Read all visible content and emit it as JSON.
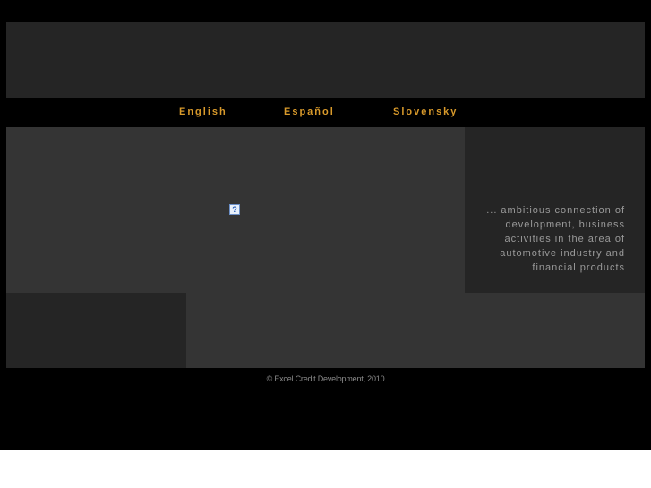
{
  "languages": [
    {
      "label": "English"
    },
    {
      "label": "Español"
    },
    {
      "label": "Slovensky"
    }
  ],
  "main": {
    "broken_image_glyph": "?",
    "tagline": "... ambitious connection of development, business activities in the area of automotive industry and financial products"
  },
  "footer": {
    "copyright": "© Excel Credit Development, 2010"
  },
  "colors": {
    "background": "#000000",
    "panel_dark": "#252525",
    "panel_mid": "#343434",
    "accent": "#d99a2b"
  }
}
